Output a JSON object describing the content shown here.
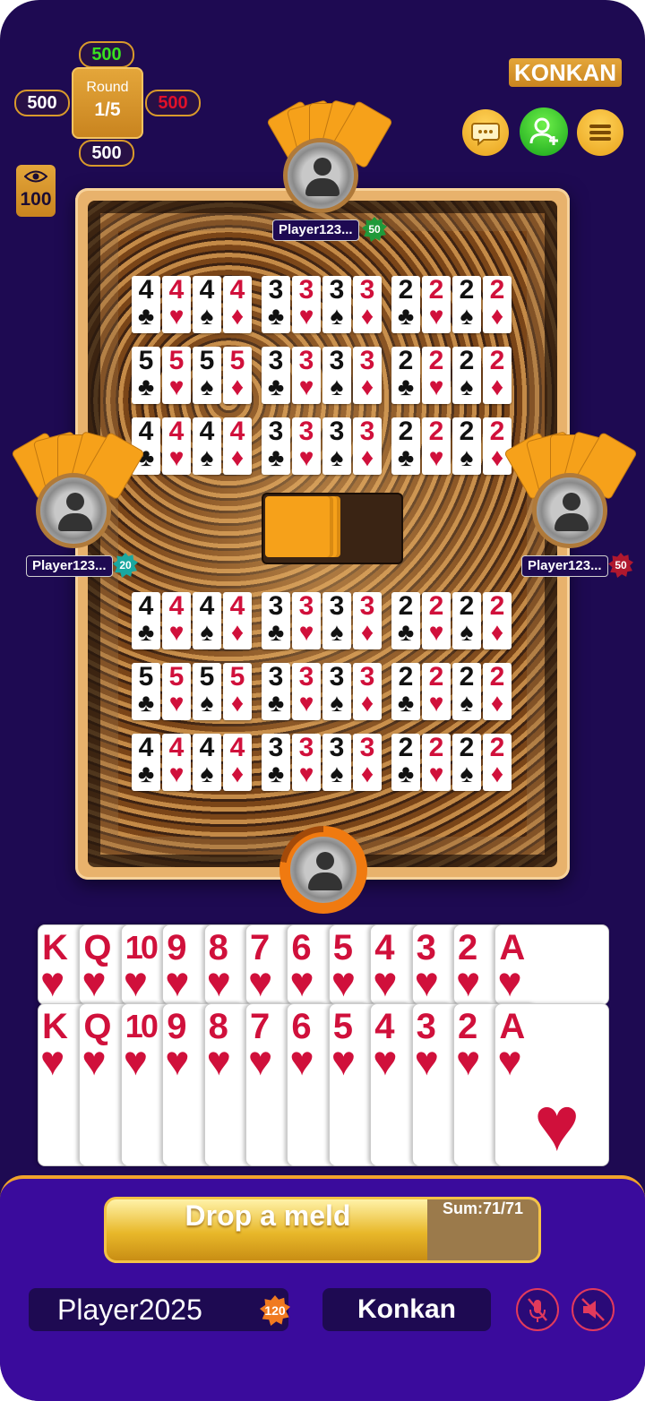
{
  "scores": {
    "top": "500",
    "left": "500",
    "right": "500",
    "bottom": "500",
    "top_color": "#39e020",
    "right_color": "#e0102a"
  },
  "round": {
    "label": "Round",
    "value": "1/5"
  },
  "spectators": {
    "count": "100"
  },
  "game_title": "KONKAN",
  "top_buttons": [
    {
      "icon": "chat-icon",
      "color": "#f2b52d"
    },
    {
      "icon": "add-friend-icon",
      "color": "#2bc42b"
    },
    {
      "icon": "menu-icon",
      "color": "#f2b52d"
    }
  ],
  "opponents": {
    "top": {
      "name": "Player123...",
      "level": "50",
      "level_color": "#1f9a3a"
    },
    "left": {
      "name": "Player123...",
      "level": "20",
      "level_color": "#1aa8a0"
    },
    "right": {
      "name": "Player123...",
      "level": "50",
      "level_color": "#b0182e"
    }
  },
  "melds": [
    [
      [
        {
          "r": "4",
          "s": "♣"
        },
        {
          "r": "4",
          "s": "♥"
        },
        {
          "r": "4",
          "s": "♠"
        },
        {
          "r": "4",
          "s": "♦"
        }
      ],
      [
        {
          "r": "3",
          "s": "♣"
        },
        {
          "r": "3",
          "s": "♥"
        },
        {
          "r": "3",
          "s": "♠"
        },
        {
          "r": "3",
          "s": "♦"
        }
      ],
      [
        {
          "r": "2",
          "s": "♣"
        },
        {
          "r": "2",
          "s": "♥"
        },
        {
          "r": "2",
          "s": "♠"
        },
        {
          "r": "2",
          "s": "♦"
        }
      ]
    ],
    [
      [
        {
          "r": "5",
          "s": "♣"
        },
        {
          "r": "5",
          "s": "♥"
        },
        {
          "r": "5",
          "s": "♠"
        },
        {
          "r": "5",
          "s": "♦"
        }
      ],
      [
        {
          "r": "3",
          "s": "♣"
        },
        {
          "r": "3",
          "s": "♥"
        },
        {
          "r": "3",
          "s": "♠"
        },
        {
          "r": "3",
          "s": "♦"
        }
      ],
      [
        {
          "r": "2",
          "s": "♣"
        },
        {
          "r": "2",
          "s": "♥"
        },
        {
          "r": "2",
          "s": "♠"
        },
        {
          "r": "2",
          "s": "♦"
        }
      ]
    ],
    [
      [
        {
          "r": "4",
          "s": "♣"
        },
        {
          "r": "4",
          "s": "♥"
        },
        {
          "r": "4",
          "s": "♠"
        },
        {
          "r": "4",
          "s": "♦"
        }
      ],
      [
        {
          "r": "3",
          "s": "♣"
        },
        {
          "r": "3",
          "s": "♥"
        },
        {
          "r": "3",
          "s": "♠"
        },
        {
          "r": "3",
          "s": "♦"
        }
      ],
      [
        {
          "r": "2",
          "s": "♣"
        },
        {
          "r": "2",
          "s": "♥"
        },
        {
          "r": "2",
          "s": "♠"
        },
        {
          "r": "2",
          "s": "♦"
        }
      ]
    ],
    [
      [
        {
          "r": "4",
          "s": "♣"
        },
        {
          "r": "4",
          "s": "♥"
        },
        {
          "r": "4",
          "s": "♠"
        },
        {
          "r": "4",
          "s": "♦"
        }
      ],
      [
        {
          "r": "3",
          "s": "♣"
        },
        {
          "r": "3",
          "s": "♥"
        },
        {
          "r": "3",
          "s": "♠"
        },
        {
          "r": "3",
          "s": "♦"
        }
      ],
      [
        {
          "r": "2",
          "s": "♣"
        },
        {
          "r": "2",
          "s": "♥"
        },
        {
          "r": "2",
          "s": "♠"
        },
        {
          "r": "2",
          "s": "♦"
        }
      ]
    ],
    [
      [
        {
          "r": "5",
          "s": "♣"
        },
        {
          "r": "5",
          "s": "♥"
        },
        {
          "r": "5",
          "s": "♠"
        },
        {
          "r": "5",
          "s": "♦"
        }
      ],
      [
        {
          "r": "3",
          "s": "♣"
        },
        {
          "r": "3",
          "s": "♥"
        },
        {
          "r": "3",
          "s": "♠"
        },
        {
          "r": "3",
          "s": "♦"
        }
      ],
      [
        {
          "r": "2",
          "s": "♣"
        },
        {
          "r": "2",
          "s": "♥"
        },
        {
          "r": "2",
          "s": "♠"
        },
        {
          "r": "2",
          "s": "♦"
        }
      ]
    ],
    [
      [
        {
          "r": "4",
          "s": "♣"
        },
        {
          "r": "4",
          "s": "♥"
        },
        {
          "r": "4",
          "s": "♠"
        },
        {
          "r": "4",
          "s": "♦"
        }
      ],
      [
        {
          "r": "3",
          "s": "♣"
        },
        {
          "r": "3",
          "s": "♥"
        },
        {
          "r": "3",
          "s": "♠"
        },
        {
          "r": "3",
          "s": "♦"
        }
      ],
      [
        {
          "r": "2",
          "s": "♣"
        },
        {
          "r": "2",
          "s": "♥"
        },
        {
          "r": "2",
          "s": "♠"
        },
        {
          "r": "2",
          "s": "♦"
        }
      ]
    ]
  ],
  "hand": {
    "row1": [
      "K",
      "Q",
      "10",
      "9",
      "8",
      "7",
      "6",
      "5",
      "4",
      "3",
      "2",
      "A"
    ],
    "row2": [
      "K",
      "Q",
      "10",
      "9",
      "8",
      "7",
      "6",
      "5",
      "4",
      "3",
      "2",
      "A"
    ],
    "suit": "♥"
  },
  "drop_button": {
    "label": "Drop a meld",
    "sum": "Sum:71/71"
  },
  "player": {
    "name": "Player2025",
    "level": "120"
  },
  "mode": "Konkan",
  "colors": {
    "background": "#1e0a52",
    "panel": "#3a0b9c",
    "gold": "#e4a63a",
    "red_suit": "#d0103b",
    "timer_ring": "#f07a10"
  }
}
